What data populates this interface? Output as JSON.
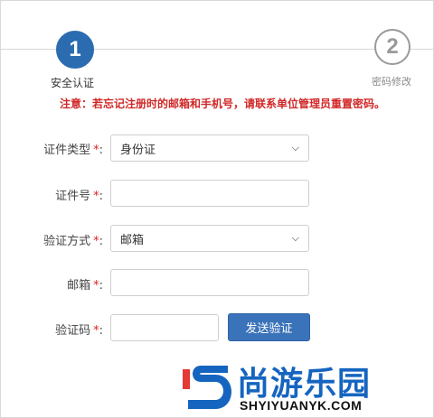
{
  "stepper": {
    "steps": [
      {
        "number": "1",
        "label": "安全认证",
        "state": "active"
      },
      {
        "number": "2",
        "label": "密码修改",
        "state": "inactive"
      }
    ]
  },
  "notice": "注意：若忘记注册时的邮箱和手机号，请联系单位管理员重置密码。",
  "form": {
    "required_mark": "*",
    "colon": ":",
    "doc_type": {
      "label": "证件类型",
      "value": "身份证"
    },
    "doc_number": {
      "label": "证件号",
      "value": ""
    },
    "verify_method": {
      "label": "验证方式",
      "value": "邮箱"
    },
    "email": {
      "label": "邮箱",
      "value": ""
    },
    "code": {
      "label": "验证码",
      "value": "",
      "button": "发送验证"
    }
  },
  "watermark": {
    "brand": "尚游乐园",
    "domain": "SHYIYUANYK.COM"
  },
  "colors": {
    "primary": "#2b6cb0",
    "danger": "#d02828",
    "button": "#3a73b9"
  }
}
